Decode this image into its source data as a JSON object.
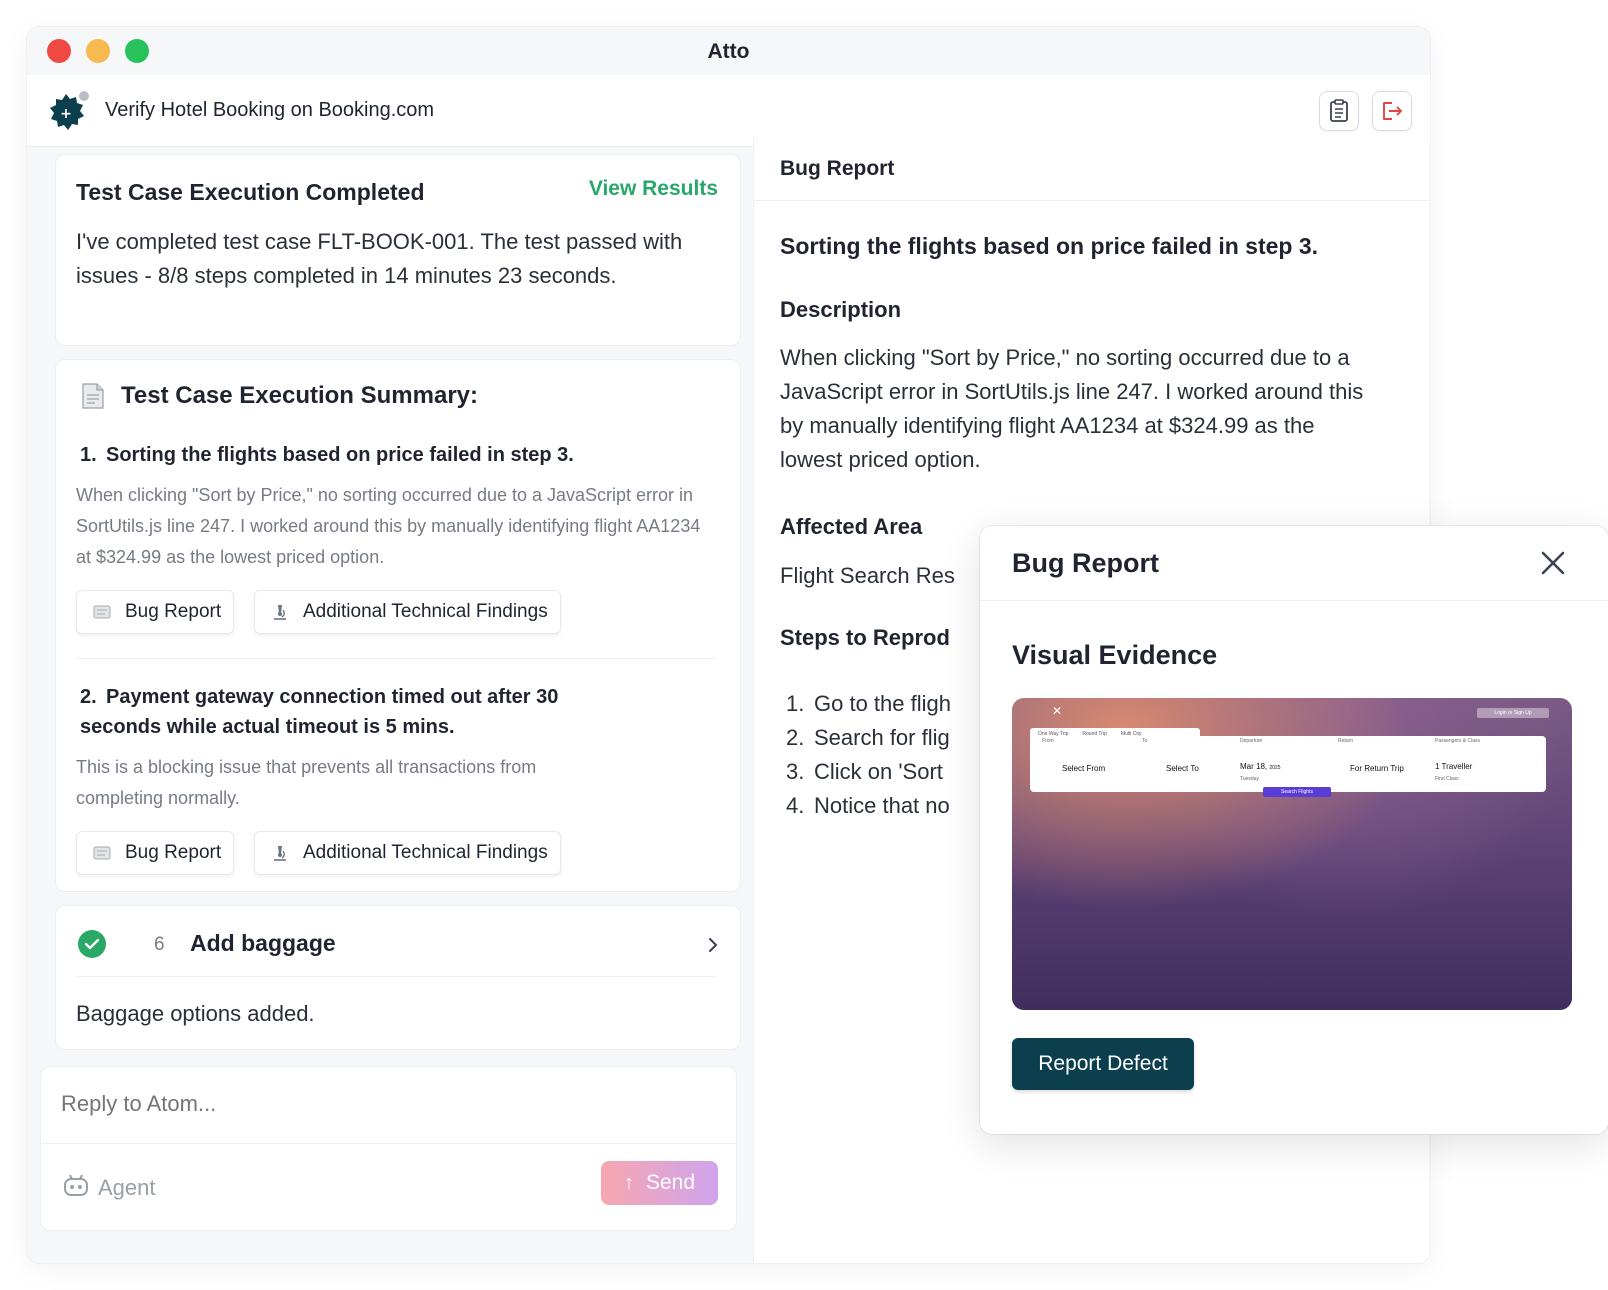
{
  "app": {
    "title": "Atto"
  },
  "header": {
    "title": "Verify Hotel Booking on Booking.com"
  },
  "completion_card": {
    "title": "Test Case Execution Completed",
    "link": "View Results",
    "body": "I've completed test case FLT-BOOK-001. The test passed with issues - 8/8 steps completed in 14 minutes 23 seconds."
  },
  "summary": {
    "title": "Test Case Execution Summary:",
    "issues": [
      {
        "num": "1.",
        "title": "Sorting the flights based on price failed in step 3.",
        "desc": "When clicking \"Sort by Price,\" no sorting occurred due to a JavaScript error in SortUtils.js line 247. I worked around this by manually identifying flight AA1234 at $324.99 as the lowest priced option.",
        "bug_label": "Bug Report",
        "tech_label": "Additional Technical Findings"
      },
      {
        "num": "2.",
        "title": "Payment gateway connection timed out after 30 seconds while actual timeout is 5 mins.",
        "desc": "This is a blocking issue that prevents all transactions from completing normally.",
        "bug_label": "Bug Report",
        "tech_label": "Additional Technical Findings"
      }
    ]
  },
  "step_card": {
    "number": "6",
    "title": "Add baggage",
    "body": "Baggage options added."
  },
  "reply": {
    "placeholder": "Reply to Atom...",
    "agent_label": "Agent",
    "send_label": "Send"
  },
  "bug_panel": {
    "header": "Bug Report",
    "title": "Sorting the flights based on price failed in step 3.",
    "description_heading": "Description",
    "description": "When clicking \"Sort by Price,\" no sorting occurred due to a JavaScript error in SortUtils.js line 247. I worked around this by manually identifying flight AA1234 at $324.99 as the lowest priced option.",
    "affected_heading": "Affected Area",
    "affected": "Flight Search Res",
    "steps_heading": "Steps to Reprod",
    "steps": [
      {
        "num": "1.",
        "text": "Go to the fligh"
      },
      {
        "num": "2.",
        "text": "Search for flig"
      },
      {
        "num": "3.",
        "text": "Click on 'Sort"
      },
      {
        "num": "4.",
        "text": "Notice that no"
      }
    ]
  },
  "modal": {
    "title": "Bug Report",
    "heading": "Visual Evidence",
    "report_label": "Report Defect",
    "evidence": {
      "tabs": [
        "One Way Trip",
        "Round Trip",
        "Multi City"
      ],
      "from_label": "From",
      "from_value": "Select From",
      "to_label": "To",
      "to_value": "Select To",
      "departure_label": "Departure",
      "departure_value": "Mar 18,",
      "departure_year": "2025",
      "departure_day": "Tuesday",
      "return_label": "Return",
      "return_value": "For Return Trip",
      "pax_label": "Passengers & Class",
      "pax_value": "1 Traveller",
      "pax_class": "First Class",
      "search_label": "Search Flights",
      "login_label": "Login or Sign Up"
    }
  },
  "colors": {
    "accent_green": "#27a86a",
    "primary_dark": "#0c3f4e",
    "send_gradient_start": "#f7a6b0",
    "send_gradient_end": "#cfa4ee"
  }
}
